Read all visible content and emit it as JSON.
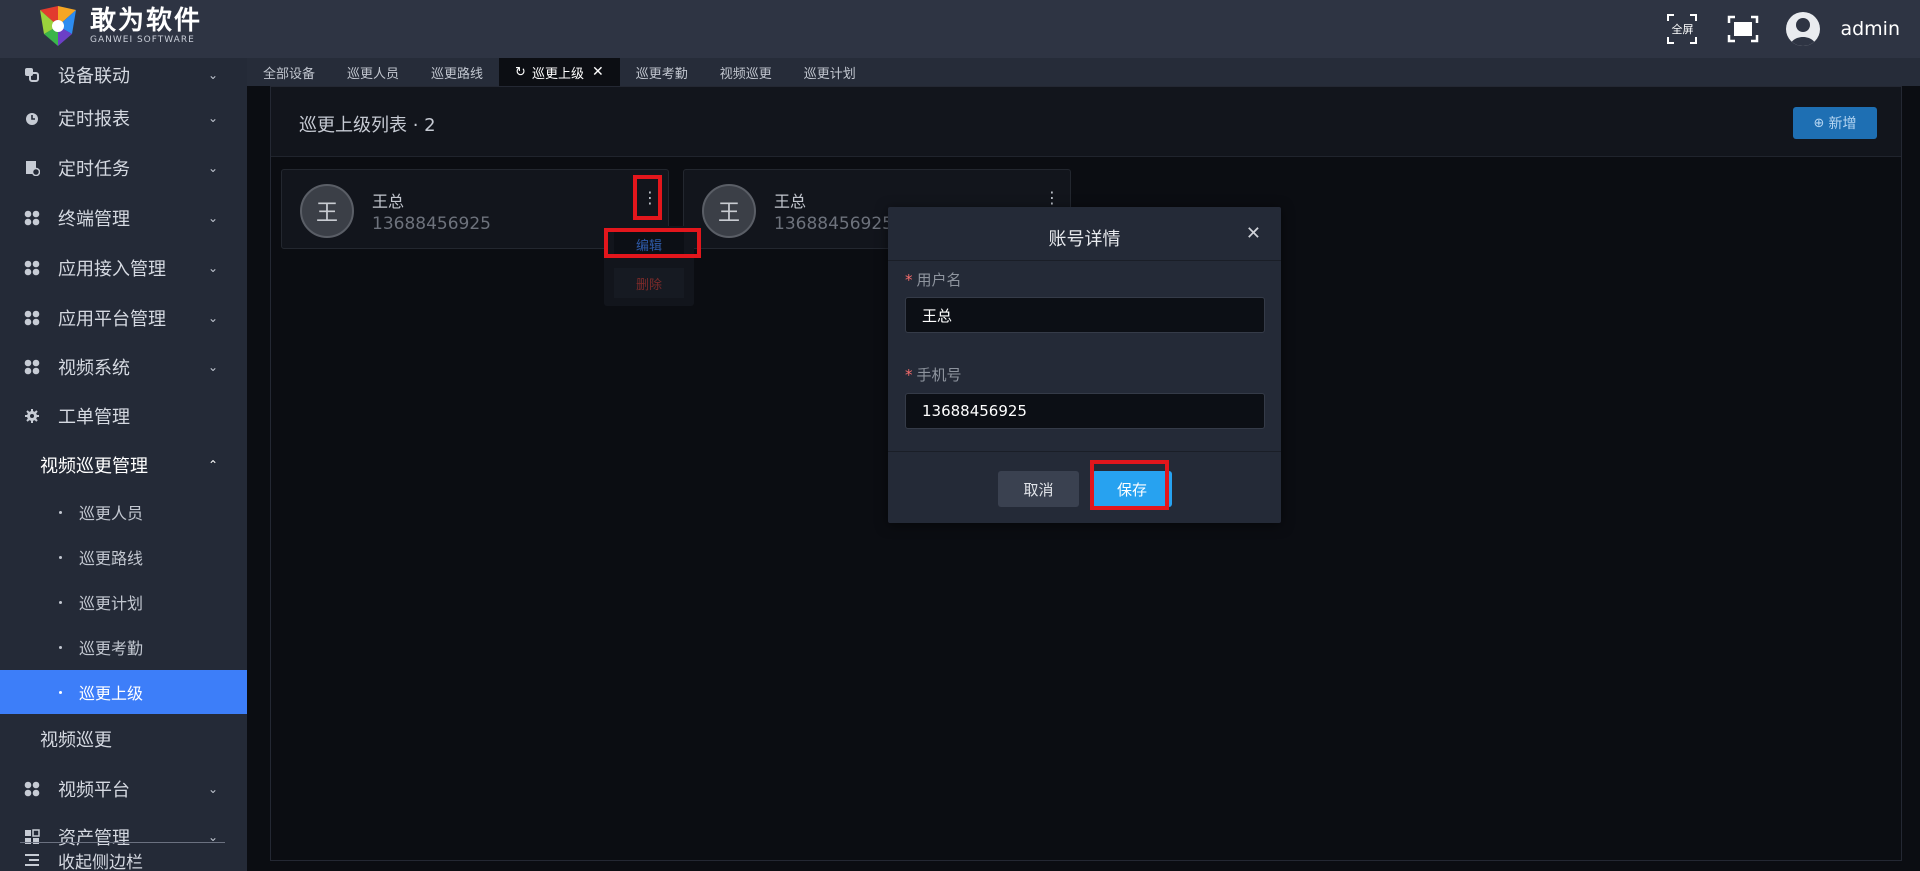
{
  "header": {
    "logo_cn": "敢为软件",
    "logo_en": "GANWEI SOFTWARE",
    "fullscreen_label": "全屏",
    "user_name": "admin"
  },
  "sidebar": {
    "items": [
      {
        "label": "设备联动",
        "icon": "link-icon"
      },
      {
        "label": "定时报表",
        "icon": "clock-report-icon"
      },
      {
        "label": "定时任务",
        "icon": "task-icon"
      },
      {
        "label": "终端管理",
        "icon": "grid-icon"
      },
      {
        "label": "应用接入管理",
        "icon": "grid-icon"
      },
      {
        "label": "应用平台管理",
        "icon": "grid-icon"
      },
      {
        "label": "视频系统",
        "icon": "grid-icon"
      },
      {
        "label": "工单管理",
        "icon": "gear-icon"
      }
    ],
    "group": {
      "label": "视频巡更管理"
    },
    "sub_items": [
      {
        "label": "巡更人员"
      },
      {
        "label": "巡更路线"
      },
      {
        "label": "巡更计划"
      },
      {
        "label": "巡更考勤"
      },
      {
        "label": "巡更上级"
      }
    ],
    "video_patrol": "视频巡更",
    "video_platform": "视频平台",
    "asset_mgmt": "资产管理",
    "collapse": "收起侧边栏"
  },
  "tabs": [
    "全部设备",
    "巡更人员",
    "巡更路线",
    "巡更上级",
    "巡更考勤",
    "视频巡更",
    "巡更计划"
  ],
  "main": {
    "title": "巡更上级列表 · 2",
    "new_button": "新增",
    "cards": [
      {
        "avatar": "王",
        "name": "王总",
        "phone": "13688456925"
      },
      {
        "avatar": "王",
        "name": "王总",
        "phone": "13688456925"
      }
    ],
    "menu_edit": "编辑",
    "menu_delete": "删除"
  },
  "modal": {
    "title": "账号详情",
    "username_label": "用户名",
    "username_value": "王总",
    "phone_label": "手机号",
    "phone_value": "13688456925",
    "cancel": "取消",
    "save": "保存"
  },
  "colors": {
    "accent": "#3d7ef9",
    "save": "#27a2f0",
    "highlight": "#e3161c"
  }
}
